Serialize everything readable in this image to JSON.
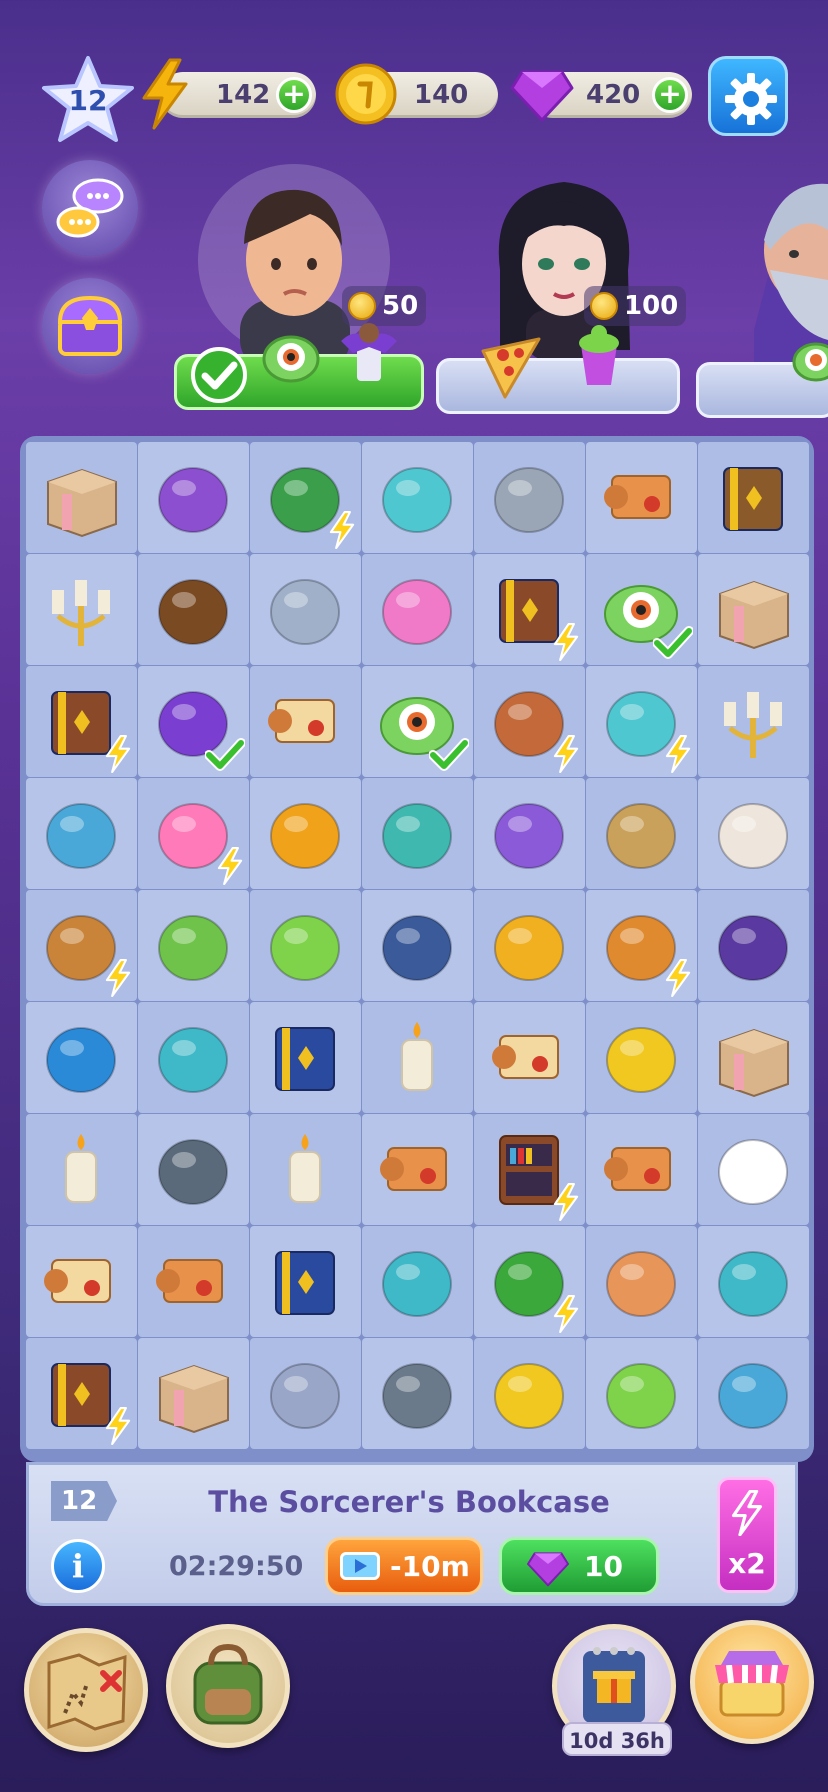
{
  "hud": {
    "level": "12",
    "energy": "142",
    "coins": "140",
    "gems": "420",
    "plus_label": "+"
  },
  "characters": [
    {
      "name_icon": "boy-portrait",
      "reward": "50",
      "completed": true
    },
    {
      "name_icon": "goth-girl-portrait",
      "reward": "100",
      "completed": false
    },
    {
      "name_icon": "wizard-portrait",
      "reward": "",
      "completed": false
    }
  ],
  "board": {
    "rows": [
      [
        {
          "icon": "cardboard-box"
        },
        {
          "icon": "spider-web-flower"
        },
        {
          "icon": "green-stove",
          "bolt": true
        },
        {
          "icon": "knitted-ghost"
        },
        {
          "icon": "winch-hook"
        },
        {
          "icon": "scroll"
        },
        {
          "icon": "books-shelf"
        }
      ],
      [
        {
          "icon": "candelabra"
        },
        {
          "icon": "hawk"
        },
        {
          "icon": "claw-ribbon"
        },
        {
          "icon": "pink-monster"
        },
        {
          "icon": "bookcase",
          "bolt": true
        },
        {
          "icon": "eye-slime",
          "check": true
        },
        {
          "icon": "cardboard-box"
        }
      ],
      [
        {
          "icon": "bookcase",
          "bolt": true
        },
        {
          "icon": "bat-totem",
          "check": true
        },
        {
          "icon": "rune-scroll"
        },
        {
          "icon": "eye-slime",
          "check": true
        },
        {
          "icon": "spinning-wheel",
          "bolt": true
        },
        {
          "icon": "boat",
          "bolt": true
        },
        {
          "icon": "candelabra"
        }
      ],
      [
        {
          "icon": "dagger"
        },
        {
          "icon": "candy-bowl",
          "bolt": true
        },
        {
          "icon": "pocket-watch"
        },
        {
          "icon": "voodoo-doll"
        },
        {
          "icon": "spider-robot"
        },
        {
          "icon": "paper-bag"
        },
        {
          "icon": "embroidery"
        }
      ],
      [
        {
          "icon": "doctor-bag",
          "bolt": true
        },
        {
          "icon": "monster-purse"
        },
        {
          "icon": "thread-spool"
        },
        {
          "icon": "quill"
        },
        {
          "icon": "axe"
        },
        {
          "icon": "sewing-machine",
          "bolt": true
        },
        {
          "icon": "button-eye-doll"
        }
      ],
      [
        {
          "icon": "compass"
        },
        {
          "icon": "knitted-cat"
        },
        {
          "icon": "spell-book"
        },
        {
          "icon": "candle"
        },
        {
          "icon": "sealed-scroll"
        },
        {
          "icon": "fishing-rod"
        },
        {
          "icon": "cardboard-box"
        }
      ],
      [
        {
          "icon": "candle"
        },
        {
          "icon": "waffle-iron"
        },
        {
          "icon": "melted-candle"
        },
        {
          "icon": "scroll"
        },
        {
          "icon": "cabinet",
          "bolt": true
        },
        {
          "icon": "scroll"
        },
        {
          "icon": "fox-mask"
        }
      ],
      [
        {
          "icon": "sealed-scroll"
        },
        {
          "icon": "scroll"
        },
        {
          "icon": "spell-book"
        },
        {
          "icon": "knitted-owl"
        },
        {
          "icon": "green-monster-bag",
          "bolt": true
        },
        {
          "icon": "hot-dog"
        },
        {
          "icon": "knitted-octopus"
        }
      ],
      [
        {
          "icon": "bookcase",
          "bolt": true
        },
        {
          "icon": "cardboard-box"
        },
        {
          "icon": "shuriken"
        },
        {
          "icon": "pigeon"
        },
        {
          "icon": "candle-plate"
        },
        {
          "icon": "net"
        },
        {
          "icon": "spiked-knuckles"
        }
      ]
    ]
  },
  "info": {
    "level": "12",
    "title": "The Sorcerer's Bookcase",
    "info_label": "i",
    "timer": "02:29:50",
    "ad_label": "-10m",
    "gem_cost": "10",
    "multiplier": "x2"
  },
  "bottom": {
    "calendar_timer": "10d 36h"
  },
  "colors": {
    "bg_top": "#4a2f8c",
    "board": "#aebde6",
    "energy_bolt": "#f5b50c",
    "green": "#2fa52a",
    "pink": "#c52fc2",
    "orange": "#e85e0e"
  }
}
